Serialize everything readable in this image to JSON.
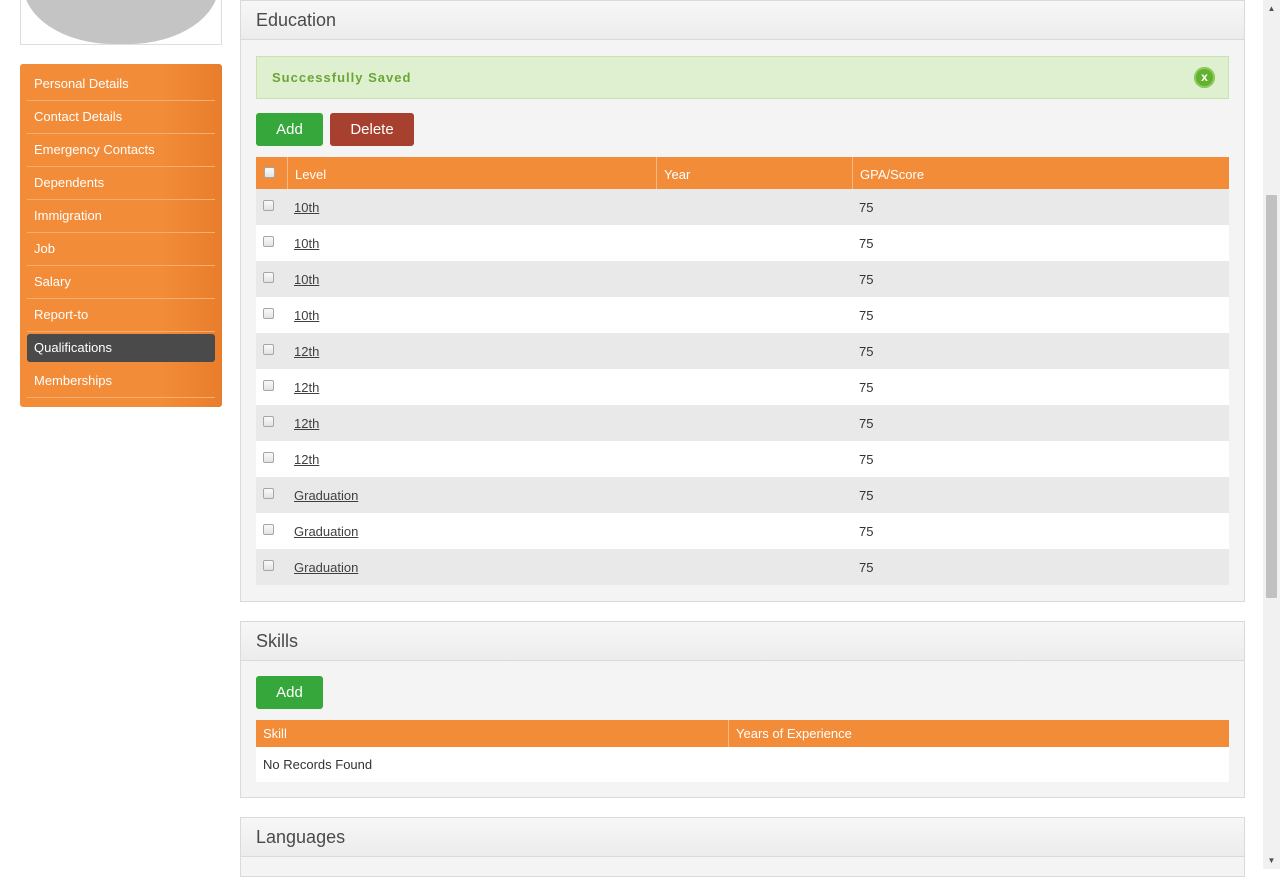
{
  "sidebar": {
    "items": [
      {
        "label": "Personal Details"
      },
      {
        "label": "Contact Details"
      },
      {
        "label": "Emergency Contacts"
      },
      {
        "label": "Dependents"
      },
      {
        "label": "Immigration"
      },
      {
        "label": "Job"
      },
      {
        "label": "Salary"
      },
      {
        "label": "Report-to"
      },
      {
        "label": "Qualifications",
        "active": true
      },
      {
        "label": "Memberships"
      }
    ]
  },
  "education": {
    "title": "Education",
    "alert": {
      "message": "Successfully Saved",
      "close": "x"
    },
    "add_label": "Add",
    "delete_label": "Delete",
    "columns": {
      "level": "Level",
      "year": "Year",
      "gpa": "GPA/Score"
    },
    "rows": [
      {
        "level": "10th",
        "year": "",
        "gpa": "75"
      },
      {
        "level": "10th",
        "year": "",
        "gpa": "75"
      },
      {
        "level": "10th",
        "year": "",
        "gpa": "75"
      },
      {
        "level": "10th",
        "year": "",
        "gpa": "75"
      },
      {
        "level": "12th",
        "year": "",
        "gpa": "75"
      },
      {
        "level": "12th",
        "year": "",
        "gpa": "75"
      },
      {
        "level": "12th",
        "year": "",
        "gpa": "75"
      },
      {
        "level": "12th",
        "year": "",
        "gpa": "75"
      },
      {
        "level": "Graduation",
        "year": "",
        "gpa": "75"
      },
      {
        "level": "Graduation",
        "year": "",
        "gpa": "75"
      },
      {
        "level": "Graduation",
        "year": "",
        "gpa": "75"
      }
    ]
  },
  "skills": {
    "title": "Skills",
    "add_label": "Add",
    "columns": {
      "skill": "Skill",
      "years": "Years of Experience"
    },
    "empty_message": "No Records Found"
  },
  "languages": {
    "title": "Languages"
  },
  "colors": {
    "brand_orange": "#f28c38",
    "active_nav": "#4a4a4a",
    "add_green": "#36a83b",
    "delete_red": "#a8402f",
    "success_bg": "#dff0d0",
    "success_text": "#6aa635"
  },
  "icons": {
    "alert_close": "close-circle-icon",
    "scroll_up": "arrow-up-icon",
    "scroll_down": "arrow-down-icon"
  }
}
